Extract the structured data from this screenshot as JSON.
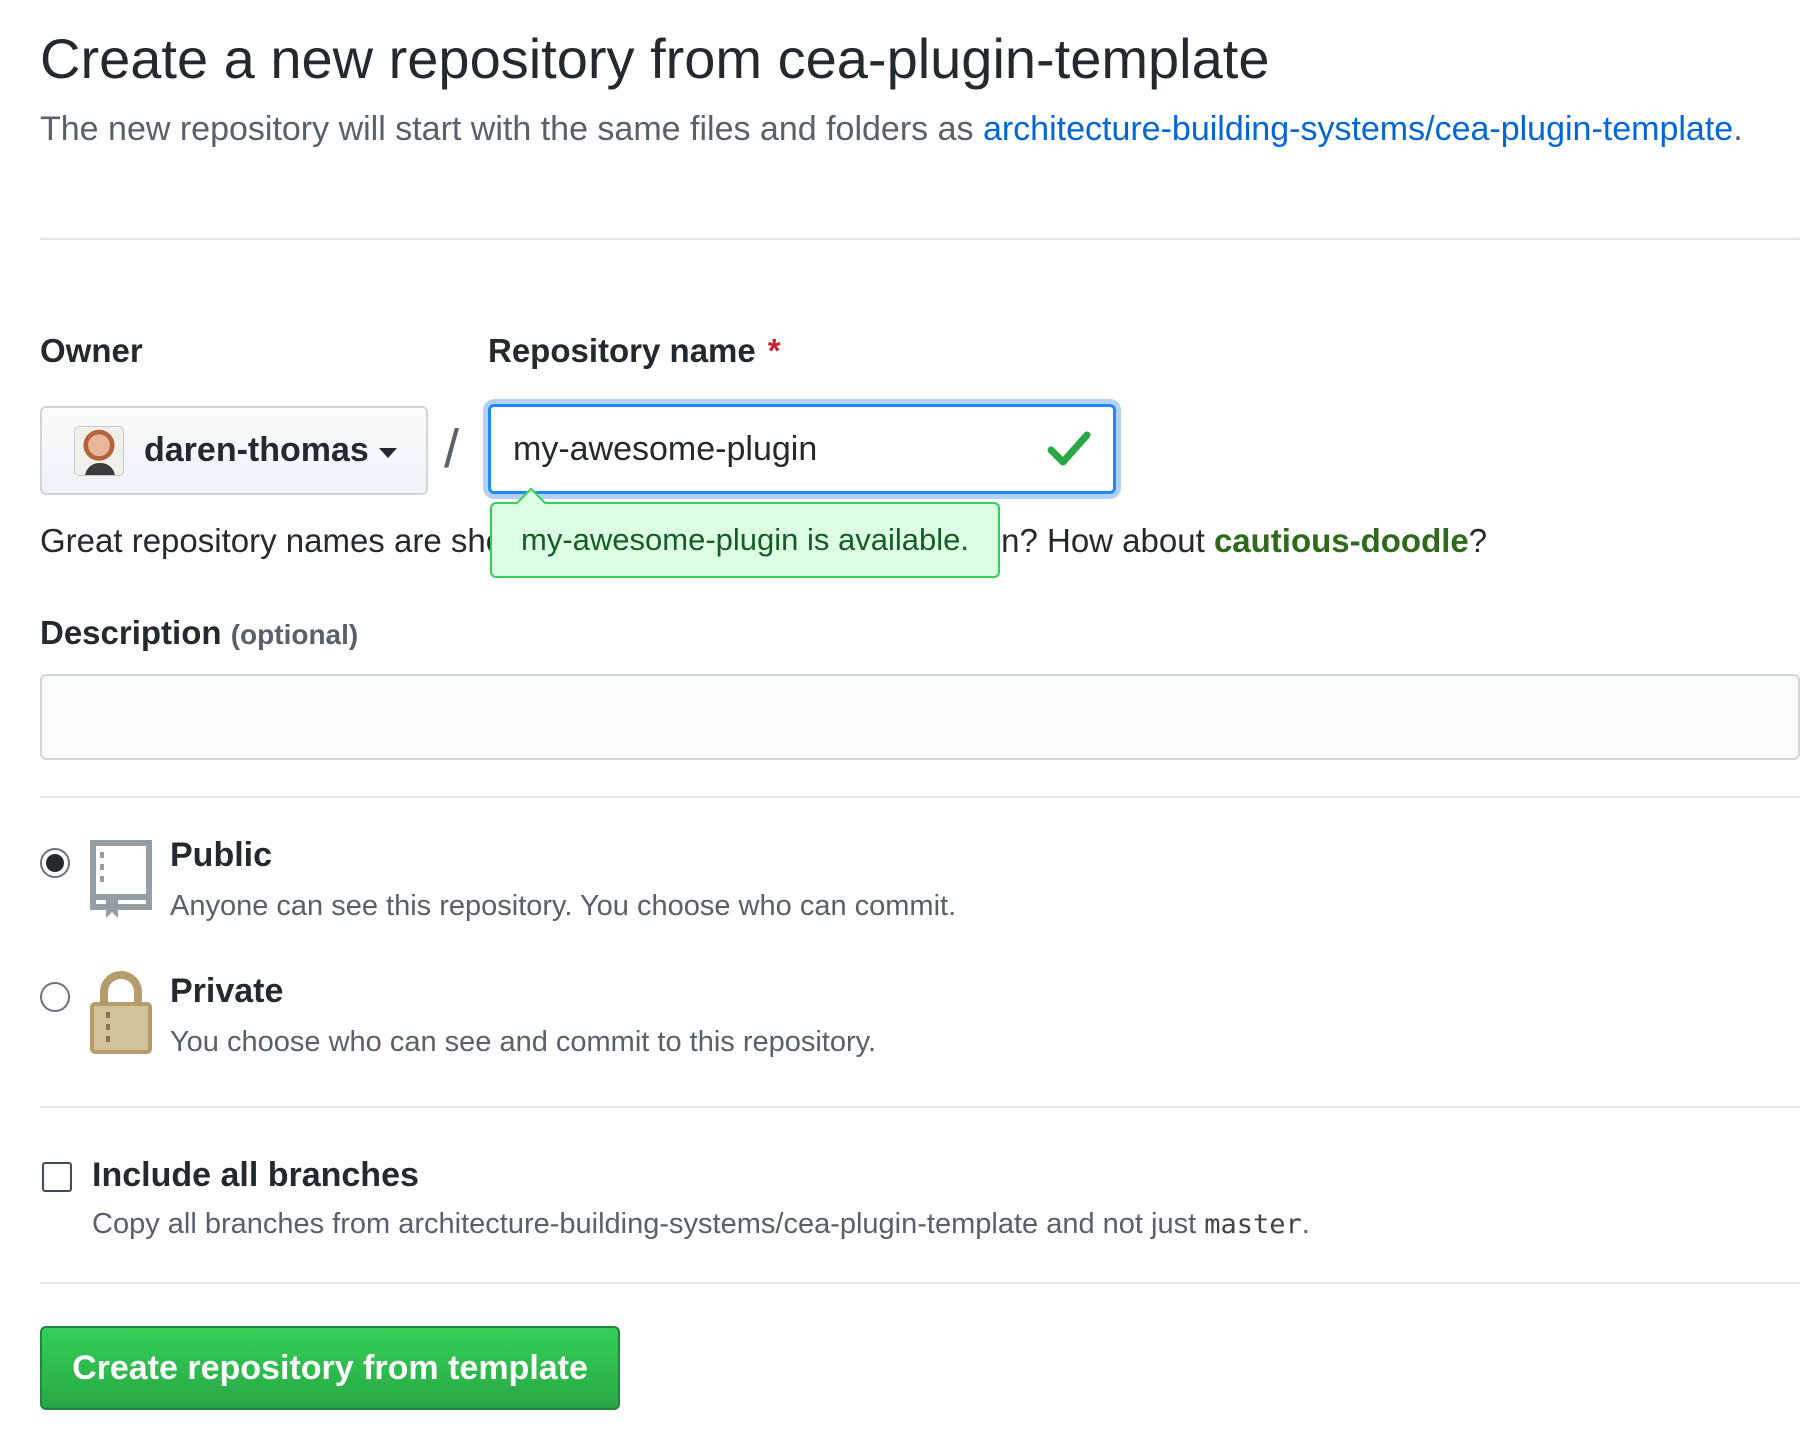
{
  "header": {
    "title": "Create a new repository from cea-plugin-template",
    "subtitle_prefix": "The new repository will start with the same files and folders as ",
    "template_link": "architecture-building-systems/cea-plugin-template",
    "subtitle_suffix": "."
  },
  "owner": {
    "label": "Owner",
    "selected": "daren-thomas"
  },
  "repo_name": {
    "label": "Repository name",
    "required_mark": "*",
    "value": "my-awesome-plugin",
    "availability": "my-awesome-plugin is available."
  },
  "hint": {
    "prefix": "Great repository names are short and memorable. Need inspiration? How about ",
    "suggestion": "cautious-doodle",
    "suffix": "?"
  },
  "description": {
    "label": "Description",
    "optional": "(optional)",
    "value": ""
  },
  "visibility": {
    "public_title": "Public",
    "public_desc": "Anyone can see this repository. You choose who can commit.",
    "private_title": "Private",
    "private_desc": "You choose who can see and commit to this repository.",
    "selected": "public"
  },
  "branches": {
    "title": "Include all branches",
    "desc_prefix": "Copy all branches from architecture-building-systems/cea-plugin-template and not just ",
    "branch": "master",
    "desc_suffix": "."
  },
  "actions": {
    "create_label": "Create repository from template"
  },
  "colors": {
    "link": "#0366d6",
    "success": "#28a745",
    "required": "#cb2431"
  }
}
